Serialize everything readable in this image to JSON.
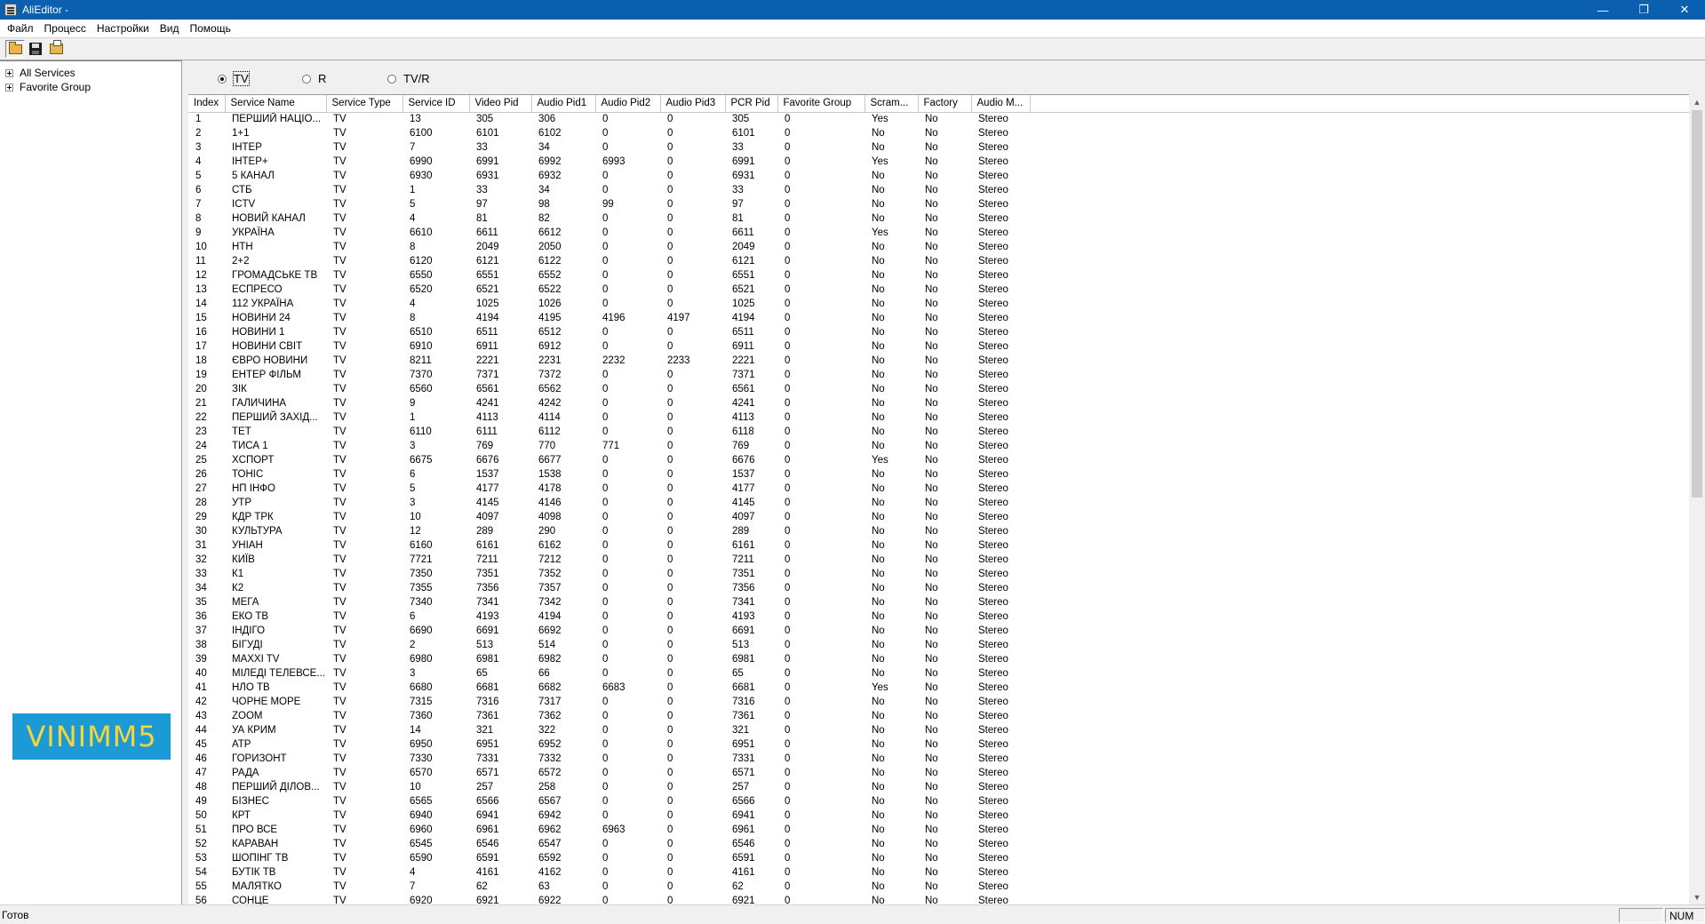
{
  "window": {
    "title": "AliEditor -"
  },
  "menu": [
    "Файл",
    "Процесс",
    "Настройки",
    "Вид",
    "Помощь"
  ],
  "toolbar": {
    "icons": [
      "open-folder-icon",
      "save-icon",
      "print-icon"
    ]
  },
  "tree": [
    {
      "label": "All Services"
    },
    {
      "label": "Favorite Group"
    }
  ],
  "logo": {
    "text": "VINIMM5",
    "background": "#1b9ad6",
    "color": "#f7d43a"
  },
  "filter": {
    "options": [
      "TV",
      "R",
      "TV/R"
    ],
    "selected": "TV"
  },
  "table": {
    "columns": [
      "Index",
      "Service Name",
      "Service Type",
      "Service ID",
      "Video Pid",
      "Audio Pid1",
      "Audio Pid2",
      "Audio Pid3",
      "PCR Pid",
      "Favorite Group",
      "Scram...",
      "Factory",
      "Audio M..."
    ],
    "rows": [
      [
        "1",
        "ПЕРШИЙ НАЦІО...",
        "TV",
        "13",
        "305",
        "306",
        "0",
        "0",
        "305",
        "0",
        "Yes",
        "No",
        "Stereo"
      ],
      [
        "2",
        "1+1",
        "TV",
        "6100",
        "6101",
        "6102",
        "0",
        "0",
        "6101",
        "0",
        "No",
        "No",
        "Stereo"
      ],
      [
        "3",
        "ІНТЕР",
        "TV",
        "7",
        "33",
        "34",
        "0",
        "0",
        "33",
        "0",
        "No",
        "No",
        "Stereo"
      ],
      [
        "4",
        "ІНТЕР+",
        "TV",
        "6990",
        "6991",
        "6992",
        "6993",
        "0",
        "6991",
        "0",
        "Yes",
        "No",
        "Stereo"
      ],
      [
        "5",
        "5 КАНАЛ",
        "TV",
        "6930",
        "6931",
        "6932",
        "0",
        "0",
        "6931",
        "0",
        "No",
        "No",
        "Stereo"
      ],
      [
        "6",
        "СТБ",
        "TV",
        "1",
        "33",
        "34",
        "0",
        "0",
        "33",
        "0",
        "No",
        "No",
        "Stereo"
      ],
      [
        "7",
        "ICTV",
        "TV",
        "5",
        "97",
        "98",
        "99",
        "0",
        "97",
        "0",
        "No",
        "No",
        "Stereo"
      ],
      [
        "8",
        "НОВИЙ КАНАЛ",
        "TV",
        "4",
        "81",
        "82",
        "0",
        "0",
        "81",
        "0",
        "No",
        "No",
        "Stereo"
      ],
      [
        "9",
        "УКРАЇНА",
        "TV",
        "6610",
        "6611",
        "6612",
        "0",
        "0",
        "6611",
        "0",
        "Yes",
        "No",
        "Stereo"
      ],
      [
        "10",
        "НТН",
        "TV",
        "8",
        "2049",
        "2050",
        "0",
        "0",
        "2049",
        "0",
        "No",
        "No",
        "Stereo"
      ],
      [
        "11",
        "2+2",
        "TV",
        "6120",
        "6121",
        "6122",
        "0",
        "0",
        "6121",
        "0",
        "No",
        "No",
        "Stereo"
      ],
      [
        "12",
        "ГРОМАДСЬКЕ ТВ",
        "TV",
        "6550",
        "6551",
        "6552",
        "0",
        "0",
        "6551",
        "0",
        "No",
        "No",
        "Stereo"
      ],
      [
        "13",
        "ЕСПРЕСО",
        "TV",
        "6520",
        "6521",
        "6522",
        "0",
        "0",
        "6521",
        "0",
        "No",
        "No",
        "Stereo"
      ],
      [
        "14",
        "112 УКРАЇНА",
        "TV",
        "4",
        "1025",
        "1026",
        "0",
        "0",
        "1025",
        "0",
        "No",
        "No",
        "Stereo"
      ],
      [
        "15",
        "НОВИНИ 24",
        "TV",
        "8",
        "4194",
        "4195",
        "4196",
        "4197",
        "4194",
        "0",
        "No",
        "No",
        "Stereo"
      ],
      [
        "16",
        "НОВИНИ 1",
        "TV",
        "6510",
        "6511",
        "6512",
        "0",
        "0",
        "6511",
        "0",
        "No",
        "No",
        "Stereo"
      ],
      [
        "17",
        "НОВИНИ СВІТ",
        "TV",
        "6910",
        "6911",
        "6912",
        "0",
        "0",
        "6911",
        "0",
        "No",
        "No",
        "Stereo"
      ],
      [
        "18",
        "ЄВРО НОВИНИ",
        "TV",
        "8211",
        "2221",
        "2231",
        "2232",
        "2233",
        "2221",
        "0",
        "No",
        "No",
        "Stereo"
      ],
      [
        "19",
        "ЕНТЕР ФІЛЬМ",
        "TV",
        "7370",
        "7371",
        "7372",
        "0",
        "0",
        "7371",
        "0",
        "No",
        "No",
        "Stereo"
      ],
      [
        "20",
        "ЗІК",
        "TV",
        "6560",
        "6561",
        "6562",
        "0",
        "0",
        "6561",
        "0",
        "No",
        "No",
        "Stereo"
      ],
      [
        "21",
        "ГАЛИЧИНА",
        "TV",
        "9",
        "4241",
        "4242",
        "0",
        "0",
        "4241",
        "0",
        "No",
        "No",
        "Stereo"
      ],
      [
        "22",
        "ПЕРШИЙ ЗАХІД...",
        "TV",
        "1",
        "4113",
        "4114",
        "0",
        "0",
        "4113",
        "0",
        "No",
        "No",
        "Stereo"
      ],
      [
        "23",
        "ТЕТ",
        "TV",
        "6110",
        "6111",
        "6112",
        "0",
        "0",
        "6118",
        "0",
        "No",
        "No",
        "Stereo"
      ],
      [
        "24",
        "ТИСА 1",
        "TV",
        "3",
        "769",
        "770",
        "771",
        "0",
        "769",
        "0",
        "No",
        "No",
        "Stereo"
      ],
      [
        "25",
        "XСПОРТ",
        "TV",
        "6675",
        "6676",
        "6677",
        "0",
        "0",
        "6676",
        "0",
        "Yes",
        "No",
        "Stereo"
      ],
      [
        "26",
        "ТОНІС",
        "TV",
        "6",
        "1537",
        "1538",
        "0",
        "0",
        "1537",
        "0",
        "No",
        "No",
        "Stereo"
      ],
      [
        "27",
        "НП ІНФО",
        "TV",
        "5",
        "4177",
        "4178",
        "0",
        "0",
        "4177",
        "0",
        "No",
        "No",
        "Stereo"
      ],
      [
        "28",
        "УТР",
        "TV",
        "3",
        "4145",
        "4146",
        "0",
        "0",
        "4145",
        "0",
        "No",
        "No",
        "Stereo"
      ],
      [
        "29",
        "КДР ТРК",
        "TV",
        "10",
        "4097",
        "4098",
        "0",
        "0",
        "4097",
        "0",
        "No",
        "No",
        "Stereo"
      ],
      [
        "30",
        "КУЛЬТУРА",
        "TV",
        "12",
        "289",
        "290",
        "0",
        "0",
        "289",
        "0",
        "No",
        "No",
        "Stereo"
      ],
      [
        "31",
        "УНІАН",
        "TV",
        "6160",
        "6161",
        "6162",
        "0",
        "0",
        "6161",
        "0",
        "No",
        "No",
        "Stereo"
      ],
      [
        "32",
        "КИЇВ",
        "TV",
        "7721",
        "7211",
        "7212",
        "0",
        "0",
        "7211",
        "0",
        "No",
        "No",
        "Stereo"
      ],
      [
        "33",
        "К1",
        "TV",
        "7350",
        "7351",
        "7352",
        "0",
        "0",
        "7351",
        "0",
        "No",
        "No",
        "Stereo"
      ],
      [
        "34",
        "К2",
        "TV",
        "7355",
        "7356",
        "7357",
        "0",
        "0",
        "7356",
        "0",
        "No",
        "No",
        "Stereo"
      ],
      [
        "35",
        "МЕГА",
        "TV",
        "7340",
        "7341",
        "7342",
        "0",
        "0",
        "7341",
        "0",
        "No",
        "No",
        "Stereo"
      ],
      [
        "36",
        "ЕКО ТВ",
        "TV",
        "6",
        "4193",
        "4194",
        "0",
        "0",
        "4193",
        "0",
        "No",
        "No",
        "Stereo"
      ],
      [
        "37",
        "ІНДІГО",
        "TV",
        "6690",
        "6691",
        "6692",
        "0",
        "0",
        "6691",
        "0",
        "No",
        "No",
        "Stereo"
      ],
      [
        "38",
        "БІГУДІ",
        "TV",
        "2",
        "513",
        "514",
        "0",
        "0",
        "513",
        "0",
        "No",
        "No",
        "Stereo"
      ],
      [
        "39",
        "MAXXI TV",
        "TV",
        "6980",
        "6981",
        "6982",
        "0",
        "0",
        "6981",
        "0",
        "No",
        "No",
        "Stereo"
      ],
      [
        "40",
        "МІЛЕДІ ТЕЛЕВСЕ...",
        "TV",
        "3",
        "65",
        "66",
        "0",
        "0",
        "65",
        "0",
        "No",
        "No",
        "Stereo"
      ],
      [
        "41",
        "НЛО ТВ",
        "TV",
        "6680",
        "6681",
        "6682",
        "6683",
        "0",
        "6681",
        "0",
        "Yes",
        "No",
        "Stereo"
      ],
      [
        "42",
        "ЧОРНЕ МОРЕ",
        "TV",
        "7315",
        "7316",
        "7317",
        "0",
        "0",
        "7316",
        "0",
        "No",
        "No",
        "Stereo"
      ],
      [
        "43",
        "ZOOM",
        "TV",
        "7360",
        "7361",
        "7362",
        "0",
        "0",
        "7361",
        "0",
        "No",
        "No",
        "Stereo"
      ],
      [
        "44",
        "УА КРИМ",
        "TV",
        "14",
        "321",
        "322",
        "0",
        "0",
        "321",
        "0",
        "No",
        "No",
        "Stereo"
      ],
      [
        "45",
        "АТР",
        "TV",
        "6950",
        "6951",
        "6952",
        "0",
        "0",
        "6951",
        "0",
        "No",
        "No",
        "Stereo"
      ],
      [
        "46",
        "ГОРИЗОНТ",
        "TV",
        "7330",
        "7331",
        "7332",
        "0",
        "0",
        "7331",
        "0",
        "No",
        "No",
        "Stereo"
      ],
      [
        "47",
        "РАДА",
        "TV",
        "6570",
        "6571",
        "6572",
        "0",
        "0",
        "6571",
        "0",
        "No",
        "No",
        "Stereo"
      ],
      [
        "48",
        "ПЕРШИЙ ДІЛОВ...",
        "TV",
        "10",
        "257",
        "258",
        "0",
        "0",
        "257",
        "0",
        "No",
        "No",
        "Stereo"
      ],
      [
        "49",
        "БІЗНЕС",
        "TV",
        "6565",
        "6566",
        "6567",
        "0",
        "0",
        "6566",
        "0",
        "No",
        "No",
        "Stereo"
      ],
      [
        "50",
        "КРТ",
        "TV",
        "6940",
        "6941",
        "6942",
        "0",
        "0",
        "6941",
        "0",
        "No",
        "No",
        "Stereo"
      ],
      [
        "51",
        "ПРО ВСЕ",
        "TV",
        "6960",
        "6961",
        "6962",
        "6963",
        "0",
        "6961",
        "0",
        "No",
        "No",
        "Stereo"
      ],
      [
        "52",
        "КАРАВАН",
        "TV",
        "6545",
        "6546",
        "6547",
        "0",
        "0",
        "6546",
        "0",
        "No",
        "No",
        "Stereo"
      ],
      [
        "53",
        "ШОПІНГ ТВ",
        "TV",
        "6590",
        "6591",
        "6592",
        "0",
        "0",
        "6591",
        "0",
        "No",
        "No",
        "Stereo"
      ],
      [
        "54",
        "БУТІК ТВ",
        "TV",
        "4",
        "4161",
        "4162",
        "0",
        "0",
        "4161",
        "0",
        "No",
        "No",
        "Stereo"
      ],
      [
        "55",
        "МАЛЯТКО",
        "TV",
        "7",
        "62",
        "63",
        "0",
        "0",
        "62",
        "0",
        "No",
        "No",
        "Stereo"
      ],
      [
        "56",
        "СОНЦЕ",
        "TV",
        "6920",
        "6921",
        "6922",
        "0",
        "0",
        "6921",
        "0",
        "No",
        "No",
        "Stereo"
      ]
    ]
  },
  "statusbar": {
    "text": "Готов",
    "num": "NUM"
  }
}
